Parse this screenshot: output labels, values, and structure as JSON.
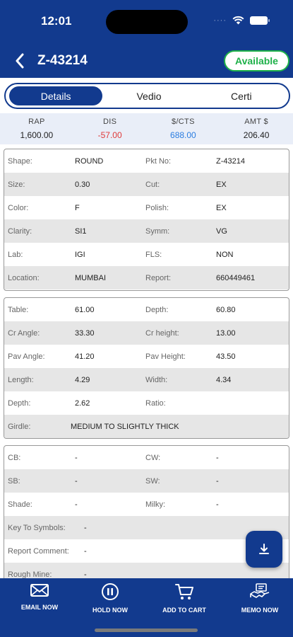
{
  "status": {
    "time": "12:01",
    "dots": "····"
  },
  "header": {
    "title": "Z-43214",
    "availability": "Available"
  },
  "tabs": [
    "Details",
    "Vedio",
    "Certi"
  ],
  "price": {
    "rap": {
      "label": "RAP",
      "value": "1,600.00"
    },
    "dis": {
      "label": "DIS",
      "value": "-57.00"
    },
    "cts": {
      "label": "$/CTS",
      "value": "688.00"
    },
    "amt": {
      "label": "AMT $",
      "value": "206.40"
    }
  },
  "basic": {
    "shape": {
      "label": "Shape:",
      "value": "ROUND"
    },
    "pkt": {
      "label": "Pkt No:",
      "value": "Z-43214"
    },
    "size": {
      "label": "Size:",
      "value": "0.30"
    },
    "cut": {
      "label": "Cut:",
      "value": "EX"
    },
    "color": {
      "label": "Color:",
      "value": "F"
    },
    "polish": {
      "label": "Polish:",
      "value": "EX"
    },
    "clarity": {
      "label": "Clarity:",
      "value": "SI1"
    },
    "symm": {
      "label": "Symm:",
      "value": "VG"
    },
    "lab": {
      "label": "Lab:",
      "value": "IGI"
    },
    "fls": {
      "label": "FLS:",
      "value": "NON"
    },
    "location": {
      "label": "Location:",
      "value": "MUMBAI"
    },
    "report": {
      "label": "Report:",
      "value": "660449461"
    }
  },
  "measure": {
    "table": {
      "label": "Table:",
      "value": "61.00"
    },
    "depth": {
      "label": "Depth:",
      "value": "60.80"
    },
    "cr_angle": {
      "label": "Cr Angle:",
      "value": "33.30"
    },
    "cr_height": {
      "label": "Cr height:",
      "value": "13.00"
    },
    "pav_angle": {
      "label": "Pav Angle:",
      "value": "41.20"
    },
    "pav_height": {
      "label": "Pav Height:",
      "value": "43.50"
    },
    "length": {
      "label": "Length:",
      "value": "4.29"
    },
    "width": {
      "label": "Width:",
      "value": "4.34"
    },
    "depth2": {
      "label": "Depth:",
      "value": "2.62"
    },
    "ratio": {
      "label": "Ratio:",
      "value": ""
    },
    "girdle": {
      "label": "Girdle:",
      "value": "MEDIUM TO SLIGHTLY THICK"
    }
  },
  "inclusion": {
    "cb": {
      "label": "CB:",
      "value": "-"
    },
    "cw": {
      "label": "CW:",
      "value": "-"
    },
    "sb": {
      "label": "SB:",
      "value": "-"
    },
    "sw": {
      "label": "SW:",
      "value": "-"
    },
    "shade": {
      "label": "Shade:",
      "value": "-"
    },
    "milky": {
      "label": "Milky:",
      "value": "-"
    },
    "key": {
      "label": "Key To Symbols:",
      "value": "-"
    },
    "comment": {
      "label": "Report Comment:",
      "value": "-"
    },
    "rough": {
      "label": "Rough Mine:",
      "value": "-"
    }
  },
  "nav": {
    "email": "EMAIL NOW",
    "hold": "HOLD NOW",
    "cart": "ADD TO CART",
    "memo": "MEMO NOW"
  },
  "colors": {
    "primary": "#123a8e",
    "available": "#1fb14a",
    "negative": "#e03a3a",
    "link": "#2b7de0"
  }
}
